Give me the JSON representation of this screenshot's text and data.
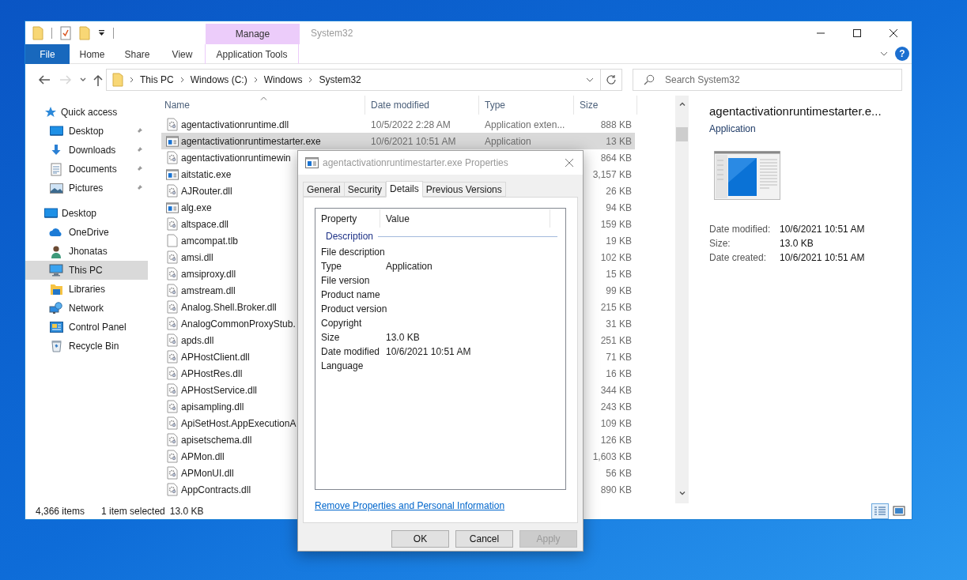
{
  "window": {
    "title": "System32",
    "context_tab": "Manage"
  },
  "ribbon_tabs": [
    {
      "label": "File",
      "kind": "file"
    },
    {
      "label": "Home",
      "kind": "plain"
    },
    {
      "label": "Share",
      "kind": "plain"
    },
    {
      "label": "View",
      "kind": "plain"
    },
    {
      "label": "Application Tools",
      "kind": "context"
    }
  ],
  "help_button": {
    "label": "?"
  },
  "nav_buttons": [
    {
      "kind": "back",
      "disabled": false
    },
    {
      "kind": "forward",
      "disabled": true
    },
    {
      "kind": "recent",
      "disabled": false
    },
    {
      "kind": "up",
      "disabled": false
    }
  ],
  "address": {
    "crumbs": [
      "This PC",
      "Windows (C:)",
      "Windows",
      "System32"
    ]
  },
  "search": {
    "placeholder": "Search System32"
  },
  "navigation": [
    {
      "label": "Quick access",
      "selected": false,
      "children": [
        {
          "label": "Desktop",
          "pinned": true,
          "selected": false
        },
        {
          "label": "Downloads",
          "pinned": true,
          "selected": false
        },
        {
          "label": "Documents",
          "pinned": true,
          "selected": false
        },
        {
          "label": "Pictures",
          "pinned": true,
          "selected": false
        }
      ]
    },
    {
      "label": "Desktop",
      "selected": false,
      "children": [
        {
          "label": "OneDrive",
          "pinned": false,
          "selected": false
        },
        {
          "label": "Jhonatas",
          "pinned": false,
          "selected": false
        },
        {
          "label": "This PC",
          "pinned": false,
          "selected": true
        },
        {
          "label": "Libraries",
          "pinned": false,
          "selected": false
        },
        {
          "label": "Network",
          "pinned": false,
          "selected": false
        },
        {
          "label": "Control Panel",
          "pinned": false,
          "selected": false
        },
        {
          "label": "Recycle Bin",
          "pinned": false,
          "selected": false
        }
      ]
    }
  ],
  "file_list": {
    "columns": [
      {
        "label": "Name",
        "sorted": true
      },
      {
        "label": "Date modified",
        "sorted": false
      },
      {
        "label": "Type",
        "sorted": false
      },
      {
        "label": "Size",
        "sorted": false
      }
    ],
    "rows": [
      {
        "kind": "dll",
        "name": "agentactivationruntime.dll",
        "date_modified": "10/5/2022 2:28 AM",
        "type": "Application exten...",
        "size": "888 KB",
        "selected": false
      },
      {
        "kind": "exe",
        "name": "agentactivationruntimestarter.exe",
        "date_modified": "10/6/2021 10:51 AM",
        "type": "Application",
        "size": "13 KB",
        "selected": true
      },
      {
        "kind": "dll",
        "name": "agentactivationruntimewin",
        "size": "864 KB",
        "selected": false
      },
      {
        "kind": "exe",
        "name": "aitstatic.exe",
        "size": "3,157 KB",
        "selected": false
      },
      {
        "kind": "dll",
        "name": "AJRouter.dll",
        "size": "26 KB",
        "selected": false
      },
      {
        "kind": "exe",
        "name": "alg.exe",
        "size": "94 KB",
        "selected": false
      },
      {
        "kind": "dll",
        "name": "altspace.dll",
        "size": "159 KB",
        "selected": false
      },
      {
        "kind": "file",
        "name": "amcompat.tlb",
        "size": "19 KB",
        "selected": false
      },
      {
        "kind": "dll",
        "name": "amsi.dll",
        "size": "102 KB",
        "selected": false
      },
      {
        "kind": "dll",
        "name": "amsiproxy.dll",
        "size": "15 KB",
        "selected": false
      },
      {
        "kind": "dll",
        "name": "amstream.dll",
        "size": "99 KB",
        "selected": false
      },
      {
        "kind": "dll",
        "name": "Analog.Shell.Broker.dll",
        "size": "215 KB",
        "selected": false
      },
      {
        "kind": "dll",
        "name": "AnalogCommonProxyStub.",
        "size": "31 KB",
        "selected": false
      },
      {
        "kind": "dll",
        "name": "apds.dll",
        "size": "251 KB",
        "selected": false
      },
      {
        "kind": "dll",
        "name": "APHostClient.dll",
        "size": "71 KB",
        "selected": false
      },
      {
        "kind": "dll",
        "name": "APHostRes.dll",
        "size": "16 KB",
        "selected": false
      },
      {
        "kind": "dll",
        "name": "APHostService.dll",
        "size": "344 KB",
        "selected": false
      },
      {
        "kind": "dll",
        "name": "apisampling.dll",
        "size": "243 KB",
        "selected": false
      },
      {
        "kind": "dll",
        "name": "ApiSetHost.AppExecutionA",
        "size": "109 KB",
        "selected": false
      },
      {
        "kind": "dll",
        "name": "apisetschema.dll",
        "size": "126 KB",
        "selected": false
      },
      {
        "kind": "dll",
        "name": "APMon.dll",
        "size": "1,603 KB",
        "selected": false
      },
      {
        "kind": "dll",
        "name": "APMonUI.dll",
        "size": "56 KB",
        "selected": false
      },
      {
        "kind": "dll",
        "name": "AppContracts.dll",
        "size": "890 KB",
        "selected": false
      }
    ]
  },
  "preview": {
    "name": "agentactivationruntimestarter.e...",
    "type": "Application",
    "details": [
      {
        "label": "Date modified:",
        "value": "10/6/2021 10:51 AM"
      },
      {
        "label": "Size:",
        "value": "13.0 KB"
      },
      {
        "label": "Date created:",
        "value": "10/6/2021 10:51 AM"
      }
    ]
  },
  "status_bar": {
    "item_count": "4,366 items",
    "selection": "1 item selected",
    "selection_size": "13.0 KB",
    "views": [
      {
        "kind": "details",
        "selected": true
      },
      {
        "kind": "large_icons",
        "selected": false
      }
    ]
  },
  "dialog": {
    "title": "agentactivationruntimestarter.exe Properties",
    "tabs": [
      {
        "label": "General",
        "selected": false
      },
      {
        "label": "Security",
        "selected": false
      },
      {
        "label": "Details",
        "selected": true
      },
      {
        "label": "Previous Versions",
        "selected": false
      }
    ],
    "columns": [
      "Property",
      "Value"
    ],
    "group": "Description",
    "properties": [
      {
        "name": "File description"
      },
      {
        "name": "Type",
        "value": "Application"
      },
      {
        "name": "File version"
      },
      {
        "name": "Product name"
      },
      {
        "name": "Product version"
      },
      {
        "name": "Copyright"
      },
      {
        "name": "Size",
        "value": "13.0 KB"
      },
      {
        "name": "Date modified",
        "value": "10/6/2021 10:51 AM"
      },
      {
        "name": "Language"
      }
    ],
    "link": "Remove Properties and Personal Information",
    "buttons": [
      {
        "label": "OK",
        "disabled": false
      },
      {
        "label": "Cancel",
        "disabled": false
      },
      {
        "label": "Apply",
        "disabled": true
      }
    ]
  }
}
